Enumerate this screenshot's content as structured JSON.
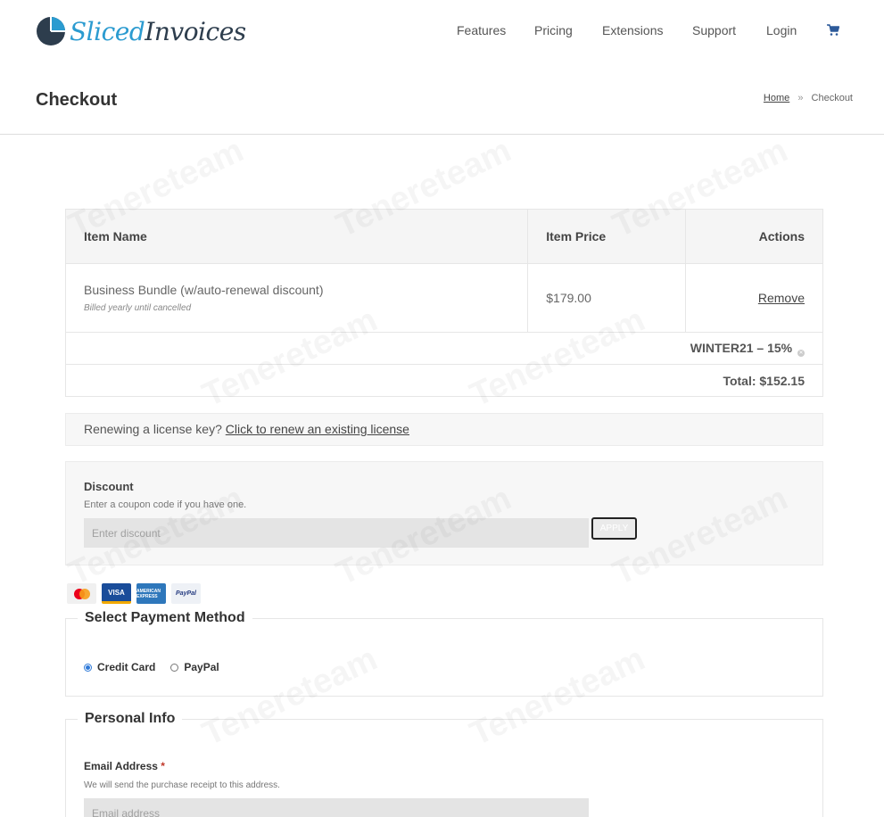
{
  "brand": {
    "name_part1": "Sliced",
    "name_part2": "Invoices"
  },
  "nav": {
    "items": [
      {
        "label": "Features"
      },
      {
        "label": "Pricing"
      },
      {
        "label": "Extensions"
      },
      {
        "label": "Support"
      },
      {
        "label": "Login"
      }
    ],
    "cart_icon": "shopping-cart-icon"
  },
  "page": {
    "title": "Checkout",
    "breadcrumb": {
      "home": "Home",
      "separator": "»",
      "current": "Checkout"
    }
  },
  "cart": {
    "headers": {
      "name": "Item Name",
      "price": "Item Price",
      "actions": "Actions"
    },
    "items": [
      {
        "name": "Business Bundle (w/auto-renewal discount)",
        "note": "Billed yearly until cancelled",
        "price": "$179.00",
        "action": "Remove"
      }
    ],
    "coupon": "WINTER21 – 15%",
    "total": "Total: $152.15"
  },
  "renew": {
    "text": "Renewing a license key?",
    "link": "Click to renew an existing license"
  },
  "discount": {
    "label": "Discount",
    "description": "Enter a coupon code if you have one.",
    "placeholder": "Enter discount",
    "apply_label": "APPLY"
  },
  "payment_icons": [
    "mastercard-icon",
    "visa-icon",
    "amex-icon",
    "paypal-icon"
  ],
  "payment_icon_labels": {
    "visa": "VISA",
    "amex": "AMERICAN EXPRESS",
    "paypal": "PayPal"
  },
  "payment_method": {
    "legend": "Select Payment Method",
    "options": [
      {
        "label": "Credit Card",
        "selected": true
      },
      {
        "label": "PayPal",
        "selected": false
      }
    ]
  },
  "personal_info": {
    "legend": "Personal Info",
    "email_label": "Email Address",
    "required_mark": "*",
    "email_description": "We will send the purchase receipt to this address.",
    "email_placeholder": "Email address"
  },
  "watermark": "Tenereteam",
  "colors": {
    "brand_blue": "#2b9bd0",
    "brand_dark": "#2d3d4d",
    "radio_accent": "#2f7ad8",
    "required": "#c0392b"
  }
}
